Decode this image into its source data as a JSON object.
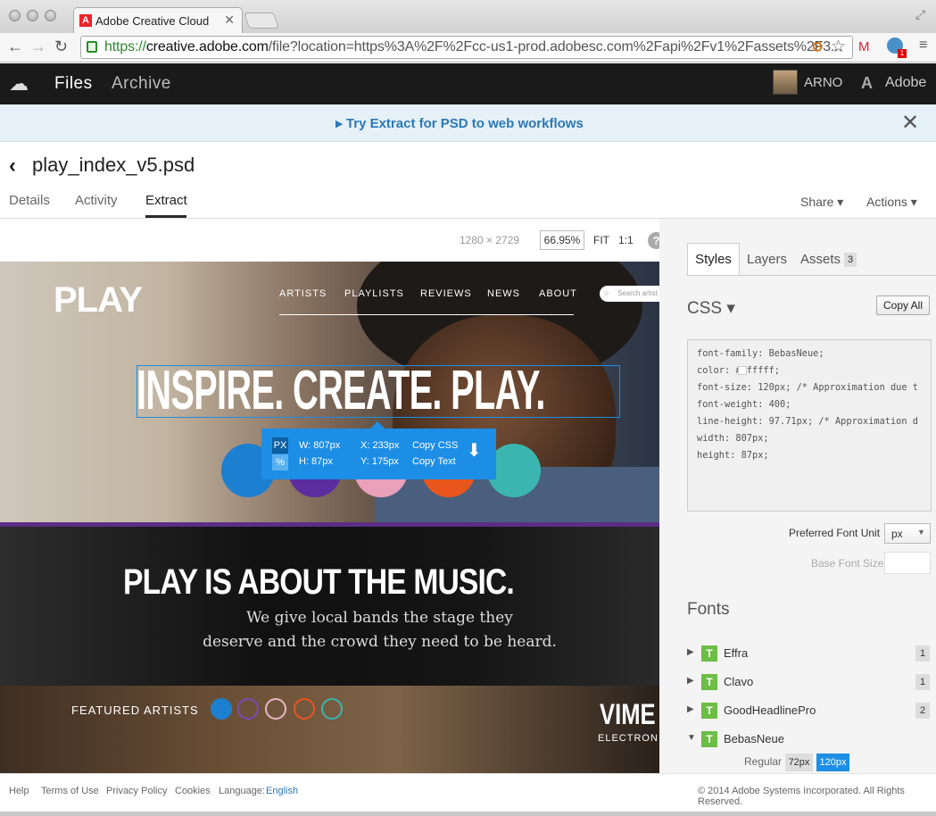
{
  "browser": {
    "tab_title": "Adobe Creative Cloud",
    "tab_favicon": "A",
    "url_scheme": "https://",
    "url_host": "creative.adobe.com",
    "url_path": "/file?location=https%3A%2F%2Fcc-us1-prod.adobesc.com%2Fapi%2Fv1%2Fassets%2F3..."
  },
  "app": {
    "nav_files": "Files",
    "nav_archive": "Archive",
    "user_name": "ARNO",
    "brand": "Adobe"
  },
  "banner": {
    "message": "▸ Try Extract for PSD to web workflows"
  },
  "file": {
    "title": "play_index_v5.psd",
    "tabs": [
      "Details",
      "Activity",
      "Extract"
    ],
    "active_tab": "Extract",
    "share_label": "Share ▾",
    "actions_label": "Actions ▾"
  },
  "canvas": {
    "size": "1280 × 2729",
    "zoom": "66.95%",
    "fit_label": "FIT",
    "one_to_one_label": "1:1",
    "help": "?"
  },
  "mockup": {
    "logo": "PLAY",
    "nav": [
      "ARTISTS",
      "PLAYLISTS",
      "REVIEWS",
      "NEWS",
      "ABOUT"
    ],
    "search_placeholder": "Search artist",
    "headline": "INSPIRE. CREATE. PLAY.",
    "section_title": "PLAY IS ABOUT THE MUSIC.",
    "section_line1": "We give local bands the stage they",
    "section_line2": "deserve and the crowd they need to be heard.",
    "featured_label": "FEATURED ARTISTS",
    "featured_name": "VIME",
    "featured_sub": "ELECTRON"
  },
  "tooltip": {
    "unit_px": "PX",
    "unit_pct": "%",
    "width": "W: 807px",
    "height": "H: 87px",
    "x": "X: 233px",
    "y": "Y: 175px",
    "copy_css": "Copy CSS",
    "copy_text": "Copy Text"
  },
  "panel": {
    "tabs": [
      "Styles",
      "Layers",
      "Assets"
    ],
    "assets_count": "3",
    "css_label": "CSS ▾",
    "copy_all": "Copy All",
    "css_lines": [
      "font-family: BebasNeue;",
      "color:    #ffffff;",
      "font-size: 120px; /* Approximation due t",
      "font-weight: 400;",
      "line-height: 97.71px; /* Approximation d",
      "width: 807px;",
      "height: 87px;"
    ],
    "pref_font_unit_label": "Preferred Font Unit",
    "pref_font_unit_value": "px",
    "base_font_size_label": "Base Font Size",
    "fonts_label": "Fonts",
    "fonts": [
      {
        "name": "Effra",
        "count": "1"
      },
      {
        "name": "Clavo",
        "count": "1"
      },
      {
        "name": "GoodHeadlinePro",
        "count": "2"
      },
      {
        "name": "BebasNeue",
        "count": ""
      }
    ],
    "regular_label": "Regular",
    "size_72": "72px",
    "size_120": "120px"
  },
  "footer": {
    "help": "Help",
    "terms": "Terms of Use",
    "privacy": "Privacy Policy",
    "cookies": "Cookies",
    "language_label": "Language:",
    "language_value": "English",
    "copyright": "© 2014 Adobe Systems Incorporated. All Rights Reserved."
  },
  "colors": {
    "accent": "#1d8ee6",
    "banner_text": "#2b78b5",
    "header_bg": "#1a1a1a"
  }
}
